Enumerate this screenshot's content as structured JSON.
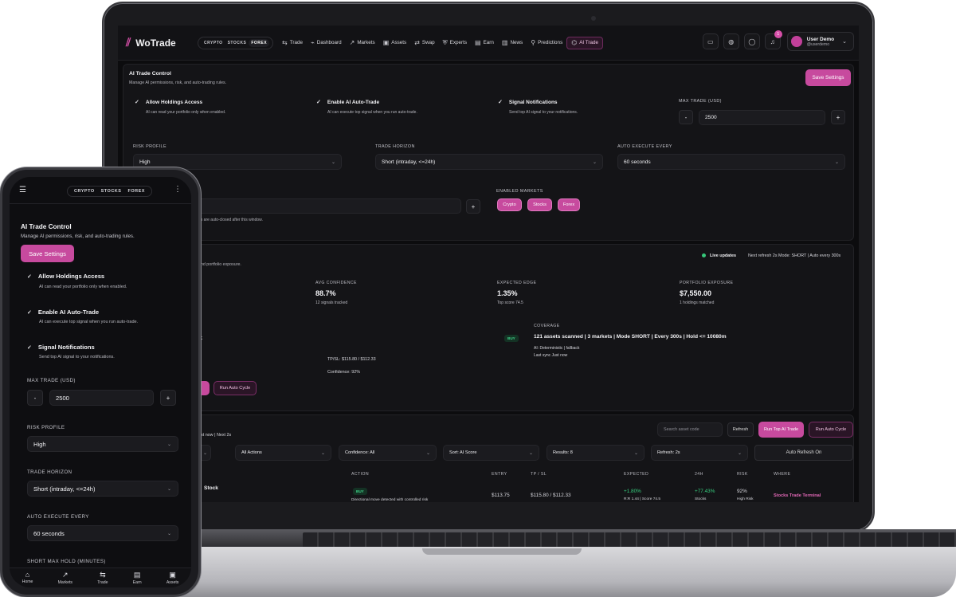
{
  "app": {
    "logo_mark": "⫽",
    "name": "WoTrade",
    "market_tabs": [
      "CRYPTO",
      "STOCKS",
      "FOREX"
    ],
    "nav": [
      {
        "icon": "trade-icon",
        "glyph": "⇆",
        "label": "Trade"
      },
      {
        "icon": "dashboard-icon",
        "glyph": "⌁",
        "label": "Dashboard"
      },
      {
        "icon": "markets-icon",
        "glyph": "↗",
        "label": "Markets"
      },
      {
        "icon": "assets-icon",
        "glyph": "▣",
        "label": "Assets"
      },
      {
        "icon": "swap-icon",
        "glyph": "⇄",
        "label": "Swap"
      },
      {
        "icon": "experts-icon",
        "glyph": "⛨",
        "label": "Experts"
      },
      {
        "icon": "earn-icon",
        "glyph": "▤",
        "label": "Earn"
      },
      {
        "icon": "news-icon",
        "glyph": "▥",
        "label": "News"
      },
      {
        "icon": "predictions-icon",
        "glyph": "⚲",
        "label": "Predictions"
      },
      {
        "icon": "ai-trade-icon",
        "glyph": "⌬",
        "label": "AI Trade"
      }
    ],
    "notification_count": "1",
    "user": {
      "name": "User Demo",
      "handle": "@userdemo"
    }
  },
  "control": {
    "title": "AI Trade Control",
    "subtitle": "Manage AI permissions, risk, and auto-trading rules.",
    "save_label": "Save Settings",
    "toggles": [
      {
        "label": "Allow Holdings Access",
        "desc": "AI can read your portfolio only when enabled."
      },
      {
        "label": "Enable AI Auto-Trade",
        "desc": "AI can execute top signal when you run auto-trade."
      },
      {
        "label": "Signal Notifications",
        "desc": "Send top AI signal to your notifications."
      }
    ],
    "max_trade_label": "MAX TRADE (USD)",
    "max_trade_value": "2500",
    "risk_label": "RISK PROFILE",
    "risk_value": "High",
    "horizon_label": "TRADE HORIZON",
    "horizon_value": "Short (intraday, <=24h)",
    "auto_exec_label": "AUTO EXECUTE EVERY",
    "auto_exec_value": "60 seconds",
    "hold_note": "ns are auto-closed after this window.",
    "enabled_markets_label": "ENABLED MARKETS",
    "enabled_markets": [
      "Crypto",
      "Stocks",
      "Forex"
    ],
    "short_hold_label": "SHORT MAX HOLD (MINUTES)"
  },
  "summary": {
    "subtitle_fragment": "and portfolio exposure.",
    "live_label": "Live updates",
    "status_line": "Next refresh 2s   Mode: SHORT | Auto every 300s",
    "stats": [
      {
        "label": "AVG CONFIDENCE",
        "value": "88.7%",
        "sub": "12 signals tracked"
      },
      {
        "label": "EXPECTED EDGE",
        "value": "1.35%",
        "sub": "Top score 74.5"
      },
      {
        "label": "PORTFOLIO EXPOSURE",
        "value": "$7,550.00",
        "sub": "1 holdings matched"
      }
    ],
    "top_fragment": "k",
    "top_action": "BUY",
    "tpsl": "TP/SL: $115.80 / $112.33",
    "confidence": "Confidence: 92%",
    "run_auto_label": "Run Auto Cycle",
    "coverage_label": "COVERAGE",
    "coverage_value": "121 assets scanned | 3 markets | Mode SHORT | Every 300s | Hold <= 10080m",
    "ai_line": "AI: Deterministic | fallback",
    "sync_line": "Last sync Just now"
  },
  "signals": {
    "header_fragment": "ust now | Next 2s",
    "search_placeholder": "Search asset code",
    "refresh_label": "Refresh",
    "run_top_label": "Run Top AI Trade",
    "run_auto_label": "Run Auto Cycle",
    "filters": [
      "All Actions",
      "Confidence: All",
      "Sort: AI Score",
      "Results: 8",
      "Refresh: 2s"
    ],
    "auto_refresh_label": "Auto Refresh On",
    "columns": [
      "ACTION",
      "ENTRY",
      "TP / SL",
      "EXPECTED",
      "24H",
      "RISK",
      "WHERE"
    ],
    "row": {
      "asset_fragment": "Stock",
      "action": "BUY",
      "desc": "Directional move detected with controlled risk",
      "entry": "$113.75",
      "tpsl": "$115.80 / $112.33",
      "expected": "+1.80%",
      "expected_sub": "R:R 1.44 | Score 74.5",
      "change": "+77.43%",
      "change_sub": "Stocks",
      "risk": "92%",
      "risk_sub": "High Risk",
      "where": "Stocks Trade Terminal"
    }
  },
  "phone": {
    "tabs": [
      {
        "icon": "home-icon",
        "glyph": "⌂",
        "label": "Home"
      },
      {
        "icon": "markets-icon",
        "glyph": "↗",
        "label": "Markets"
      },
      {
        "icon": "trade-icon",
        "glyph": "⇆",
        "label": "Trade"
      },
      {
        "icon": "earn-icon",
        "glyph": "▤",
        "label": "Earn"
      },
      {
        "icon": "assets-icon",
        "glyph": "▣",
        "label": "Assets"
      }
    ]
  },
  "colors": {
    "accent": "#c74a9e",
    "positive": "#37d07f",
    "background": "#0c0c0e"
  }
}
